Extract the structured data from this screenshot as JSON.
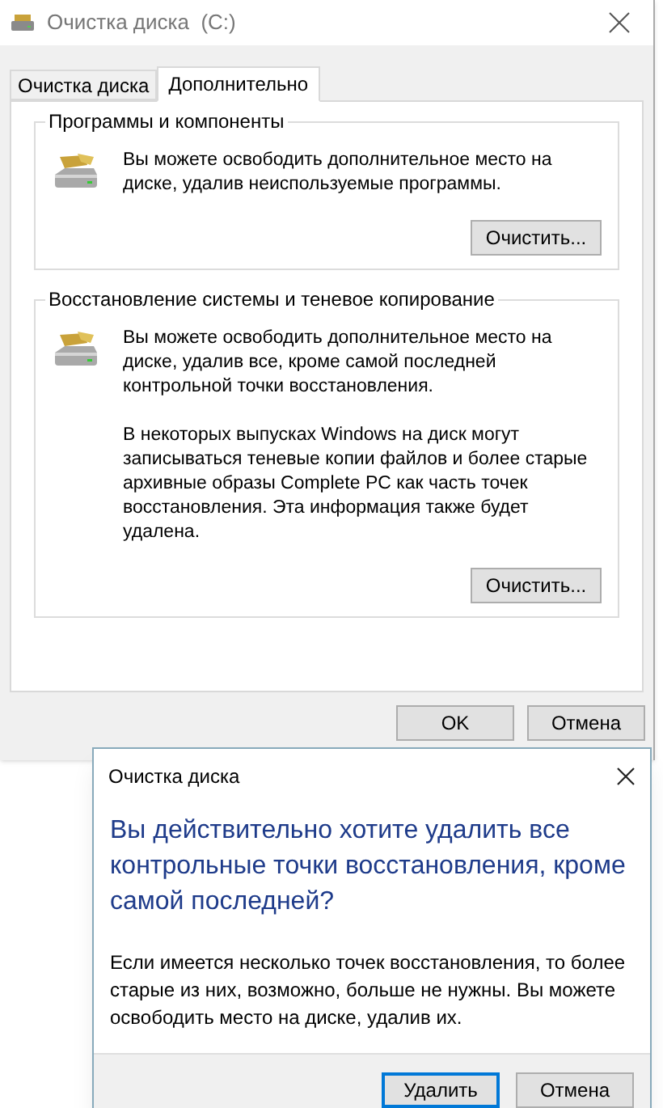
{
  "window": {
    "title": "Очистка диска  (C:)"
  },
  "tabs": [
    {
      "label": "Очистка диска",
      "selected": false
    },
    {
      "label": "Дополнительно",
      "selected": true
    }
  ],
  "groups": [
    {
      "title": "Программы и компоненты",
      "paragraphs": [
        "Вы можете освободить дополнительное место на диске, удалив неиспользуемые программы."
      ],
      "button": "Очистить..."
    },
    {
      "title": "Восстановление системы и теневое копирование",
      "paragraphs": [
        "Вы можете освободить дополнительное место на диске, удалив все, кроме самой последней контрольной точки восстановления.",
        "В некоторых выпусках Windows на диск могут записываться теневые копии файлов и более старые архивные образы Complete PC как часть точек восстановления. Эта информация также будет удалена."
      ],
      "button": "Очистить..."
    }
  ],
  "buttons": [
    {
      "label": "OK",
      "default": false
    },
    {
      "label": "Отмена",
      "default": false
    }
  ],
  "dialog": {
    "title": "Очистка диска",
    "heading": "Вы действительно хотите удалить все контрольные точки восстановления, кроме самой последней?",
    "message": "Если имеется несколько точек восстановления, то более старые из них, возможно, больше не нужны. Вы можете освободить место на диске, удалив их.",
    "buttons": [
      {
        "label": "Удалить",
        "default": true
      },
      {
        "label": "Отмена",
        "default": false
      }
    ]
  }
}
